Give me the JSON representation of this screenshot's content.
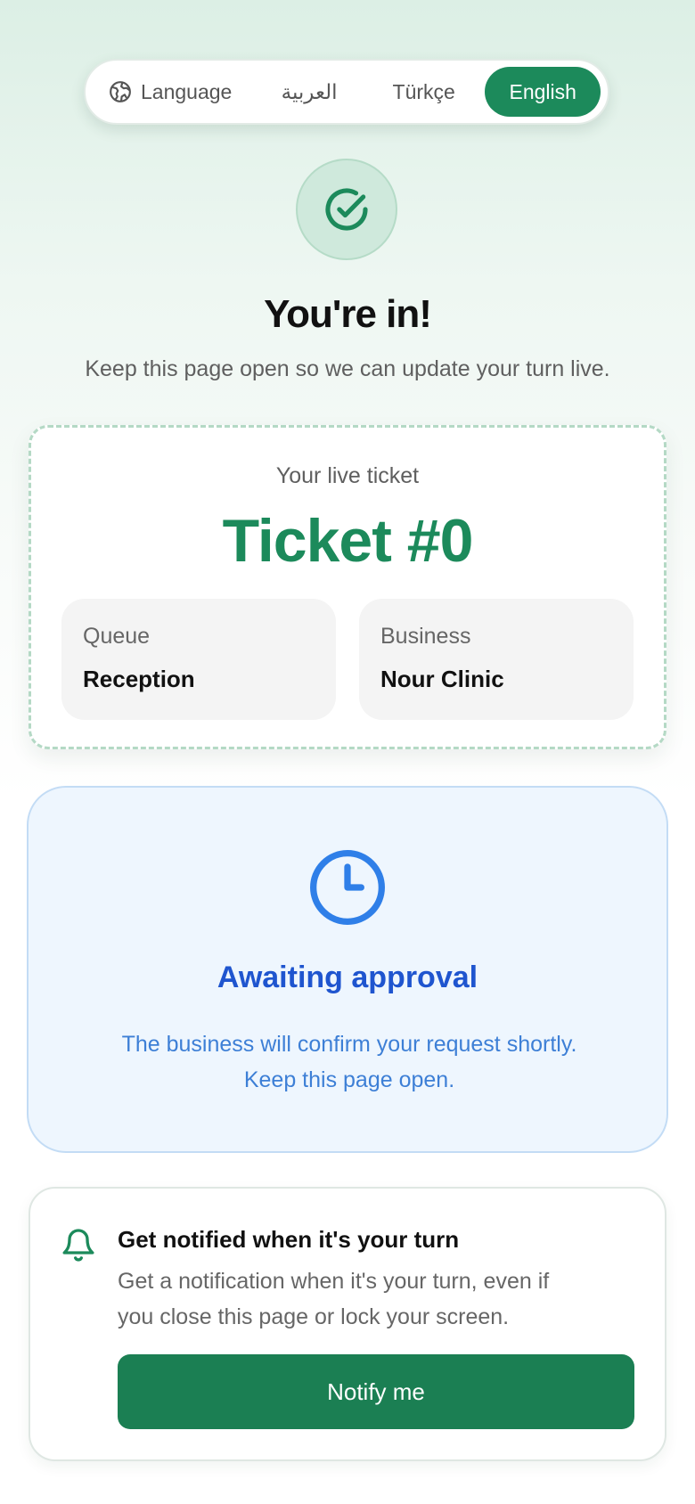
{
  "language_bar": {
    "label": "Language",
    "icon": "globe-icon",
    "options": [
      "العربية",
      "Türkçe",
      "English"
    ],
    "selected": "English",
    "accent_color": "#1c8a5b"
  },
  "header": {
    "icon": "check-circle-icon",
    "title": "You're in!",
    "subtitle": "Keep this page open so we can update your turn live."
  },
  "ticket": {
    "label": "Your live ticket",
    "number": "Ticket #0",
    "queue_label": "Queue",
    "queue_value": "Reception",
    "business_label": "Business",
    "business_value": "Nour Clinic"
  },
  "status": {
    "icon": "clock-icon",
    "title": "Awaiting approval",
    "line1": "The business will confirm your request shortly.",
    "line2": "Keep this page open."
  },
  "notify": {
    "icon": "bell-icon",
    "title": "Get notified when it's your turn",
    "line1": "Get a notification when it's your turn, even if",
    "line2": "you close this page or lock your screen.",
    "button_label": "Notify me",
    "button_color": "#1b7f53"
  }
}
